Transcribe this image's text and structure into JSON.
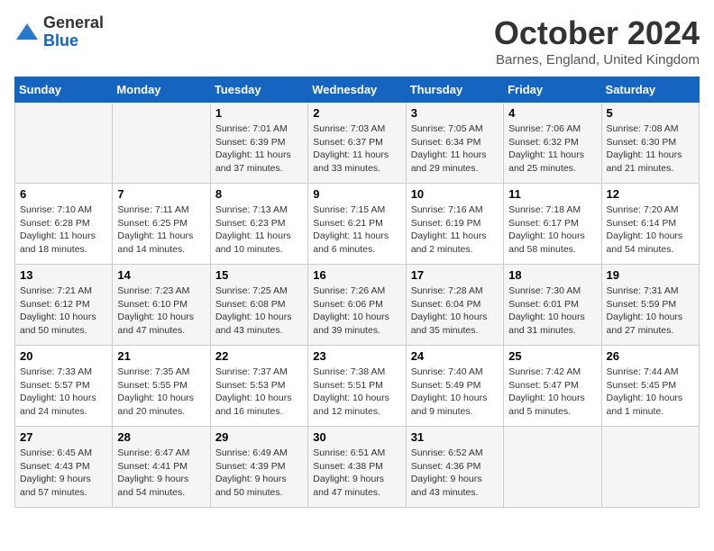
{
  "logo": {
    "general": "General",
    "blue": "Blue"
  },
  "header": {
    "month": "October 2024",
    "location": "Barnes, England, United Kingdom"
  },
  "days_of_week": [
    "Sunday",
    "Monday",
    "Tuesday",
    "Wednesday",
    "Thursday",
    "Friday",
    "Saturday"
  ],
  "weeks": [
    [
      {
        "day": "",
        "content": ""
      },
      {
        "day": "",
        "content": ""
      },
      {
        "day": "1",
        "content": "Sunrise: 7:01 AM\nSunset: 6:39 PM\nDaylight: 11 hours and 37 minutes."
      },
      {
        "day": "2",
        "content": "Sunrise: 7:03 AM\nSunset: 6:37 PM\nDaylight: 11 hours and 33 minutes."
      },
      {
        "day": "3",
        "content": "Sunrise: 7:05 AM\nSunset: 6:34 PM\nDaylight: 11 hours and 29 minutes."
      },
      {
        "day": "4",
        "content": "Sunrise: 7:06 AM\nSunset: 6:32 PM\nDaylight: 11 hours and 25 minutes."
      },
      {
        "day": "5",
        "content": "Sunrise: 7:08 AM\nSunset: 6:30 PM\nDaylight: 11 hours and 21 minutes."
      }
    ],
    [
      {
        "day": "6",
        "content": "Sunrise: 7:10 AM\nSunset: 6:28 PM\nDaylight: 11 hours and 18 minutes."
      },
      {
        "day": "7",
        "content": "Sunrise: 7:11 AM\nSunset: 6:25 PM\nDaylight: 11 hours and 14 minutes."
      },
      {
        "day": "8",
        "content": "Sunrise: 7:13 AM\nSunset: 6:23 PM\nDaylight: 11 hours and 10 minutes."
      },
      {
        "day": "9",
        "content": "Sunrise: 7:15 AM\nSunset: 6:21 PM\nDaylight: 11 hours and 6 minutes."
      },
      {
        "day": "10",
        "content": "Sunrise: 7:16 AM\nSunset: 6:19 PM\nDaylight: 11 hours and 2 minutes."
      },
      {
        "day": "11",
        "content": "Sunrise: 7:18 AM\nSunset: 6:17 PM\nDaylight: 10 hours and 58 minutes."
      },
      {
        "day": "12",
        "content": "Sunrise: 7:20 AM\nSunset: 6:14 PM\nDaylight: 10 hours and 54 minutes."
      }
    ],
    [
      {
        "day": "13",
        "content": "Sunrise: 7:21 AM\nSunset: 6:12 PM\nDaylight: 10 hours and 50 minutes."
      },
      {
        "day": "14",
        "content": "Sunrise: 7:23 AM\nSunset: 6:10 PM\nDaylight: 10 hours and 47 minutes."
      },
      {
        "day": "15",
        "content": "Sunrise: 7:25 AM\nSunset: 6:08 PM\nDaylight: 10 hours and 43 minutes."
      },
      {
        "day": "16",
        "content": "Sunrise: 7:26 AM\nSunset: 6:06 PM\nDaylight: 10 hours and 39 minutes."
      },
      {
        "day": "17",
        "content": "Sunrise: 7:28 AM\nSunset: 6:04 PM\nDaylight: 10 hours and 35 minutes."
      },
      {
        "day": "18",
        "content": "Sunrise: 7:30 AM\nSunset: 6:01 PM\nDaylight: 10 hours and 31 minutes."
      },
      {
        "day": "19",
        "content": "Sunrise: 7:31 AM\nSunset: 5:59 PM\nDaylight: 10 hours and 27 minutes."
      }
    ],
    [
      {
        "day": "20",
        "content": "Sunrise: 7:33 AM\nSunset: 5:57 PM\nDaylight: 10 hours and 24 minutes."
      },
      {
        "day": "21",
        "content": "Sunrise: 7:35 AM\nSunset: 5:55 PM\nDaylight: 10 hours and 20 minutes."
      },
      {
        "day": "22",
        "content": "Sunrise: 7:37 AM\nSunset: 5:53 PM\nDaylight: 10 hours and 16 minutes."
      },
      {
        "day": "23",
        "content": "Sunrise: 7:38 AM\nSunset: 5:51 PM\nDaylight: 10 hours and 12 minutes."
      },
      {
        "day": "24",
        "content": "Sunrise: 7:40 AM\nSunset: 5:49 PM\nDaylight: 10 hours and 9 minutes."
      },
      {
        "day": "25",
        "content": "Sunrise: 7:42 AM\nSunset: 5:47 PM\nDaylight: 10 hours and 5 minutes."
      },
      {
        "day": "26",
        "content": "Sunrise: 7:44 AM\nSunset: 5:45 PM\nDaylight: 10 hours and 1 minute."
      }
    ],
    [
      {
        "day": "27",
        "content": "Sunrise: 6:45 AM\nSunset: 4:43 PM\nDaylight: 9 hours and 57 minutes."
      },
      {
        "day": "28",
        "content": "Sunrise: 6:47 AM\nSunset: 4:41 PM\nDaylight: 9 hours and 54 minutes."
      },
      {
        "day": "29",
        "content": "Sunrise: 6:49 AM\nSunset: 4:39 PM\nDaylight: 9 hours and 50 minutes."
      },
      {
        "day": "30",
        "content": "Sunrise: 6:51 AM\nSunset: 4:38 PM\nDaylight: 9 hours and 47 minutes."
      },
      {
        "day": "31",
        "content": "Sunrise: 6:52 AM\nSunset: 4:36 PM\nDaylight: 9 hours and 43 minutes."
      },
      {
        "day": "",
        "content": ""
      },
      {
        "day": "",
        "content": ""
      }
    ]
  ]
}
